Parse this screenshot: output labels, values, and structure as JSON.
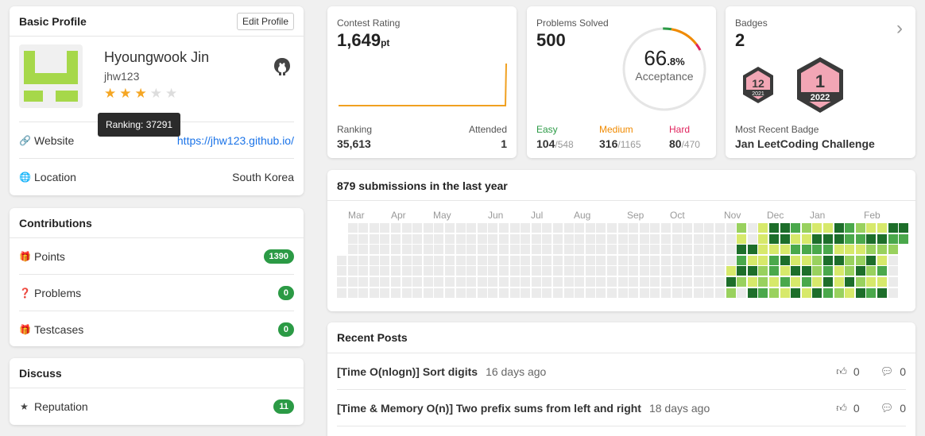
{
  "profile": {
    "header": "Basic Profile",
    "edit_label": "Edit Profile",
    "name": "Hyoungwook Jin",
    "username": "jhw123",
    "stars": 3,
    "stars_total": 5,
    "tooltip": "Ranking: 37291",
    "website_label": "Website",
    "website_value": "https://jhw123.github.io/",
    "location_label": "Location",
    "location_value": "South Korea",
    "avatar_color": "#a6d84a"
  },
  "contributions": {
    "header": "Contributions",
    "items": [
      {
        "label": "Points",
        "value": "1390"
      },
      {
        "label": "Problems",
        "value": "0"
      },
      {
        "label": "Testcases",
        "value": "0"
      }
    ]
  },
  "discuss": {
    "header": "Discuss",
    "items": [
      {
        "label": "Reputation",
        "value": "11"
      }
    ]
  },
  "contest": {
    "label": "Contest Rating",
    "rating": "1,649",
    "unit": "pt",
    "ranking_label": "Ranking",
    "ranking_value": "35,613",
    "attended_label": "Attended",
    "attended_value": "1",
    "line_color": "#f0a020"
  },
  "solved": {
    "label": "Problems Solved",
    "total": "500",
    "acceptance_int": "66",
    "acceptance_dec": ".8%",
    "acceptance_label": "Acceptance",
    "acceptance_fraction": 0.668,
    "easy_label": "Easy",
    "easy_value": "104",
    "easy_total": "/548",
    "medium_label": "Medium",
    "medium_value": "316",
    "medium_total": "/1165",
    "hard_label": "Hard",
    "hard_value": "80",
    "hard_total": "/470",
    "easy_color": "#2b9a45",
    "medium_color": "#f08a00",
    "hard_color": "#e0245e"
  },
  "badges": {
    "label": "Badges",
    "count": "2",
    "badge1_text": "12",
    "badge1_year": "2021",
    "badge2_text": "1",
    "badge2_year": "2022",
    "recent_label": "Most Recent Badge",
    "recent_value": "Jan LeetCoding Challenge"
  },
  "calendar": {
    "title": "879 submissions in the last year",
    "months": [
      "Mar",
      "Apr",
      "May",
      "Jun",
      "Jul",
      "Aug",
      "Sep",
      "Oct",
      "Nov",
      "Dec",
      "Jan",
      "Feb"
    ],
    "colors": [
      "#ebebeb",
      "#d7e96b",
      "#99d15e",
      "#4aa84b",
      "#1d6e2a"
    ]
  },
  "posts": {
    "header": "Recent Posts",
    "items": [
      {
        "title": "[Time O(nlogn)] Sort digits",
        "time": "16 days ago",
        "likes": "0",
        "comments": "0"
      },
      {
        "title": "[Time & Memory O(n)] Two prefix sums from left and right",
        "time": "18 days ago",
        "likes": "0",
        "comments": "0"
      }
    ]
  }
}
